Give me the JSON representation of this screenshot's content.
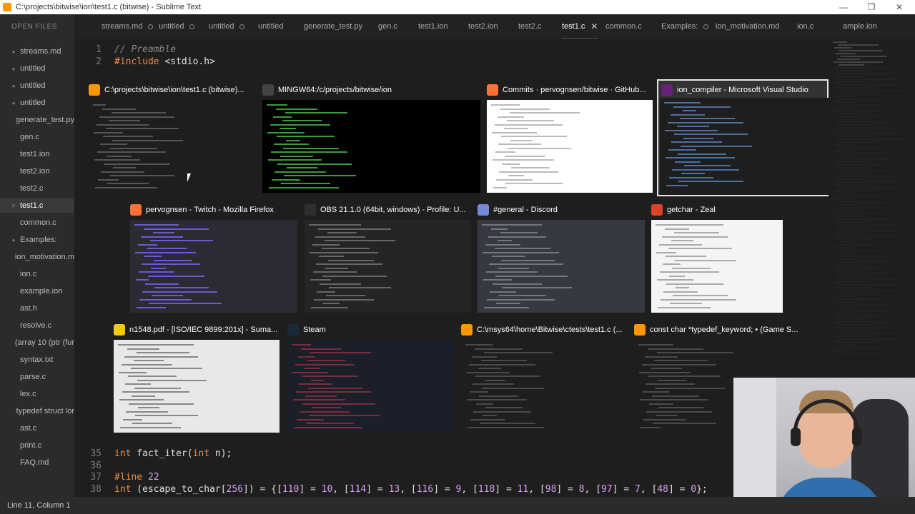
{
  "window": {
    "title": "C:\\projects\\bitwise\\ion\\test1.c (bitwise) - Sublime Text",
    "minimize": "—",
    "maximize": "❐",
    "close": "✕"
  },
  "sidebar": {
    "header": "OPEN FILES",
    "items": [
      {
        "label": "streams.md",
        "mark": "●"
      },
      {
        "label": "untitled",
        "mark": "●"
      },
      {
        "label": "untitled",
        "mark": "●"
      },
      {
        "label": "untitled",
        "mark": "●"
      },
      {
        "label": "generate_test.py",
        "mark": ""
      },
      {
        "label": "gen.c",
        "mark": ""
      },
      {
        "label": "test1.ion",
        "mark": ""
      },
      {
        "label": "test2.ion",
        "mark": ""
      },
      {
        "label": "test2.c",
        "mark": ""
      },
      {
        "label": "test1.c",
        "mark": "✕"
      },
      {
        "label": "common.c",
        "mark": ""
      },
      {
        "label": "Examples:",
        "mark": "●"
      },
      {
        "label": "ion_motivation.m",
        "mark": ""
      },
      {
        "label": "ion.c",
        "mark": ""
      },
      {
        "label": "example.ion",
        "mark": ""
      },
      {
        "label": "ast.h",
        "mark": ""
      },
      {
        "label": "resolve.c",
        "mark": ""
      },
      {
        "label": "(array 10 (ptr (fur",
        "mark": ""
      },
      {
        "label": "syntax.txt",
        "mark": ""
      },
      {
        "label": "parse.c",
        "mark": ""
      },
      {
        "label": "lex.c",
        "mark": ""
      },
      {
        "label": "typedef struct lor",
        "mark": ""
      },
      {
        "label": "ast.c",
        "mark": ""
      },
      {
        "label": "print.c",
        "mark": ""
      },
      {
        "label": "FAQ.md",
        "mark": ""
      }
    ]
  },
  "tabs": [
    {
      "label": "streams.md",
      "state": "dirty"
    },
    {
      "label": "untitled",
      "state": "dirty"
    },
    {
      "label": "untitled",
      "state": "dirty"
    },
    {
      "label": "untitled",
      "state": ""
    },
    {
      "label": "generate_test.py",
      "state": ""
    },
    {
      "label": "gen.c",
      "state": ""
    },
    {
      "label": "test1.ion",
      "state": ""
    },
    {
      "label": "test2.ion",
      "state": ""
    },
    {
      "label": "test2.c",
      "state": ""
    },
    {
      "label": "test1.c",
      "state": "active"
    },
    {
      "label": "common.c",
      "state": ""
    },
    {
      "label": "Examples:",
      "state": "dirty"
    },
    {
      "label": "ion_motivation.md",
      "state": ""
    },
    {
      "label": "ion.c",
      "state": ""
    },
    {
      "label": "ample.ion",
      "state": ""
    }
  ],
  "editor": {
    "lines_top": [
      {
        "num": "1",
        "text": "// Preamble"
      },
      {
        "num": "2",
        "text": "#include <stdio.h>"
      }
    ],
    "lines_bottom": [
      {
        "num": "35",
        "text": "int fact_iter(int n);"
      },
      {
        "num": "36",
        "text": ""
      },
      {
        "num": "37",
        "text": "#line 22"
      },
      {
        "num": "38",
        "text": "int (escape_to_char[256]) = {[110] = 10, [114] = 13, [116] = 9, [118] = 11, [98] = 8, [97] = 7, [48] = 0};"
      }
    ]
  },
  "switcher": {
    "windows": [
      {
        "title": "C:\\projects\\bitwise\\ion\\test1.c (bitwise)...",
        "icon": "sublime-icon",
        "color": "#ff9800"
      },
      {
        "title": "MINGW64:/c/projects/bitwise/ion",
        "icon": "terminal-icon",
        "color": "#444444"
      },
      {
        "title": "Commits · pervognsen/bitwise · GitHub...",
        "icon": "firefox-icon",
        "color": "#ff7139"
      },
      {
        "title": "ion_compiler - Microsoft Visual Studio",
        "icon": "visual-studio-icon",
        "color": "#68217a"
      },
      {
        "title": "pervognsen - Twitch - Mozilla Firefox",
        "icon": "firefox-icon",
        "color": "#ff7139"
      },
      {
        "title": "OBS 21.1.0 (64bit, windows) - Profile: U...",
        "icon": "obs-icon",
        "color": "#302e31"
      },
      {
        "title": "#general - Discord",
        "icon": "discord-icon",
        "color": "#7289da"
      },
      {
        "title": "getchar - Zeal",
        "icon": "zeal-icon",
        "color": "#d9452b"
      },
      {
        "title": "n1548.pdf - [ISO/IEC 9899:201x] - Suma...",
        "icon": "sumatra-pdf-icon",
        "color": "#f2c811"
      },
      {
        "title": "Steam",
        "icon": "steam-icon",
        "color": "#1b2838"
      },
      {
        "title": "C:\\msys64\\home\\Bitwise\\ctests\\test1.c (...",
        "icon": "sublime-icon",
        "color": "#ff9800"
      },
      {
        "title": "const char *typedef_keyword; • (Game S...",
        "icon": "sublime-icon",
        "color": "#ff9800"
      }
    ]
  },
  "status": {
    "position": "Line 11, Column 1"
  }
}
